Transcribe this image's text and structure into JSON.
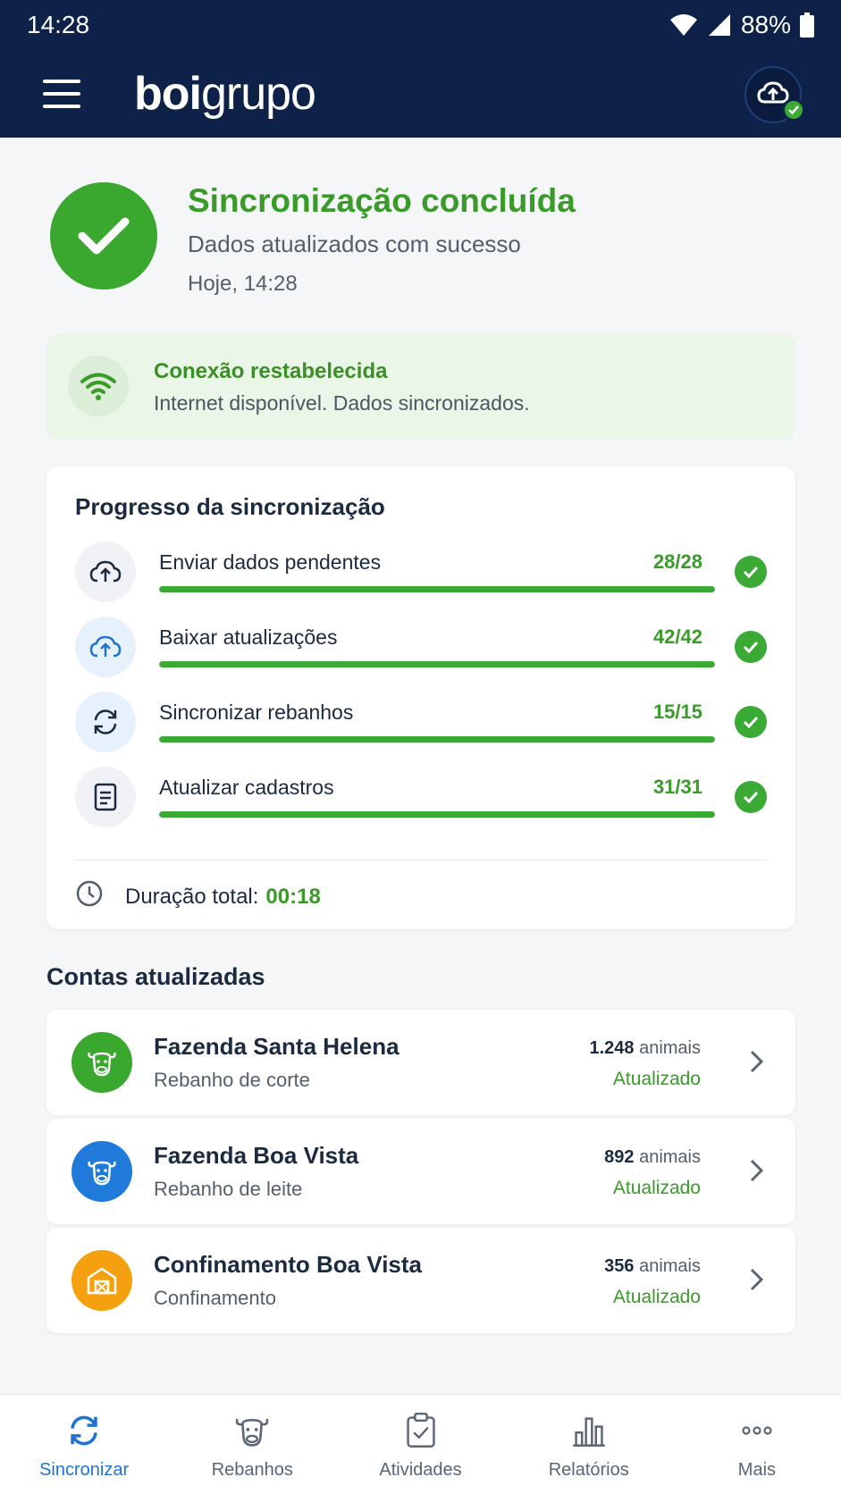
{
  "status_bar": {
    "time": "14:28",
    "battery": "88%"
  },
  "header": {
    "logo_bold": "boi",
    "logo_light": "grupo"
  },
  "hero": {
    "title": "Sincronização concluída",
    "subtitle": "Dados atualizados com sucesso",
    "timestamp": "Hoje, 14:28"
  },
  "connection": {
    "title": "Conexão restabelecida",
    "subtitle": "Internet disponível. Dados sincronizados."
  },
  "progress": {
    "title": "Progresso da sincronização",
    "items": [
      {
        "label": "Enviar dados pendentes",
        "count": "28/28",
        "fraction": 1.0,
        "icon": "cloud-upload-icon"
      },
      {
        "label": "Baixar atualizações",
        "count": "42/42",
        "fraction": 1.0,
        "icon": "cloud-download-icon"
      },
      {
        "label": "Sincronizar rebanhos",
        "count": "15/15",
        "fraction": 1.0,
        "icon": "sync-icon"
      },
      {
        "label": "Atualizar cadastros",
        "count": "31/31",
        "fraction": 1.0,
        "icon": "document-icon"
      }
    ],
    "duration_label": "Duração total:",
    "duration_value": "00:18"
  },
  "accounts": {
    "title": "Contas atualizadas",
    "items": [
      {
        "name": "Fazenda Santa Helena",
        "type": "Rebanho de corte",
        "count": "1.248",
        "unit": "animais",
        "status": "Atualizado",
        "color": "#3aa72f",
        "icon": "cow-icon"
      },
      {
        "name": "Fazenda Boa Vista",
        "type": "Rebanho de leite",
        "count": "892",
        "unit": "animais",
        "status": "Atualizado",
        "color": "#1f7ad9",
        "icon": "cow-icon"
      },
      {
        "name": "Confinamento Boa Vista",
        "type": "Confinamento",
        "count": "356",
        "unit": "animais",
        "status": "Atualizado",
        "color": "#f5a00f",
        "icon": "barn-icon"
      }
    ]
  },
  "bottom_nav": [
    {
      "label": "Sincronizar",
      "active": true
    },
    {
      "label": "Rebanhos"
    },
    {
      "label": "Atividades"
    },
    {
      "label": "Relatórios"
    },
    {
      "label": "Mais"
    }
  ],
  "colors": {
    "header": "#0d2149",
    "success": "#3aaa35",
    "active_nav": "#1f73d3"
  }
}
